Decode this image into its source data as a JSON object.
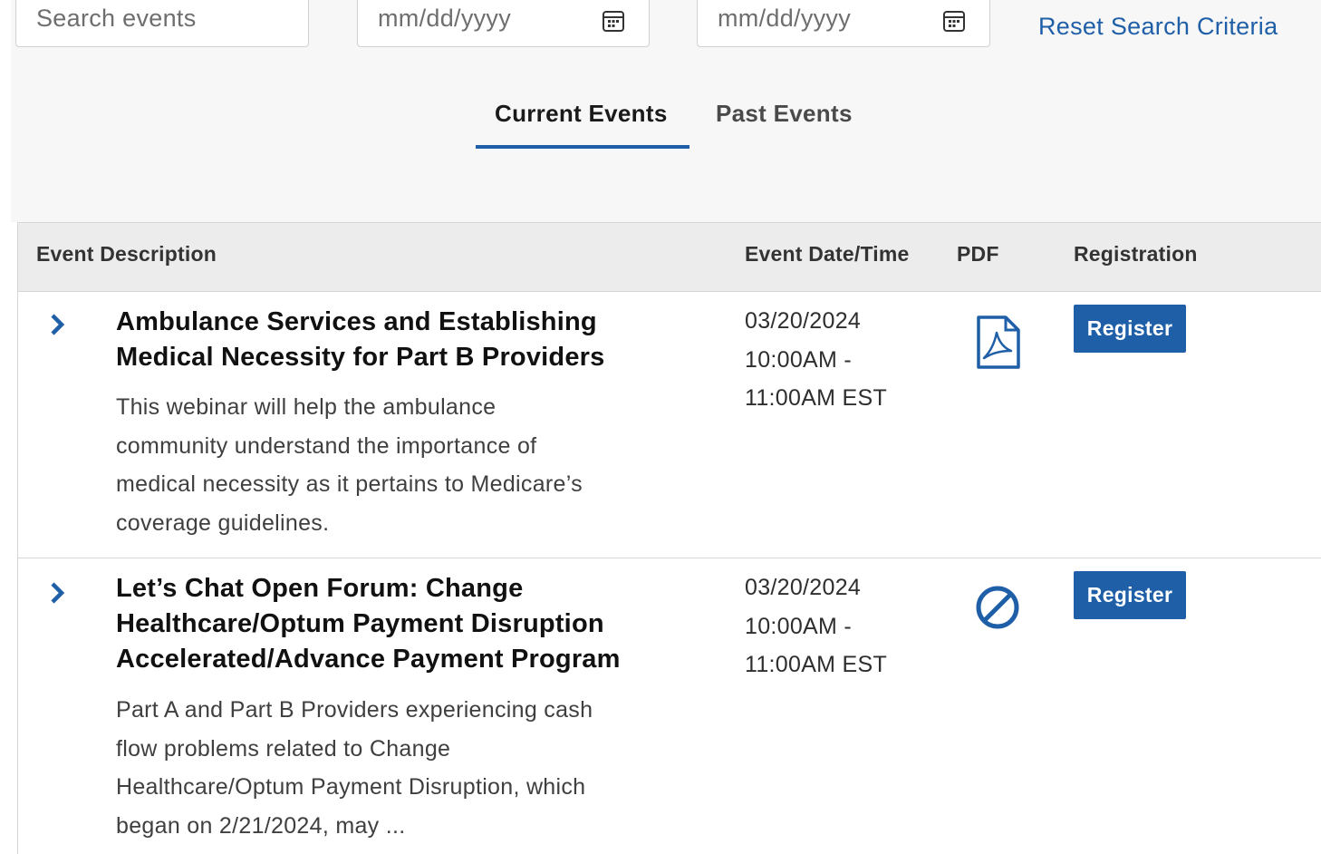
{
  "filters": {
    "search": {
      "placeholder": "Search events",
      "value": ""
    },
    "start_date": {
      "placeholder": "mm/dd/yyyy",
      "value": ""
    },
    "end_date": {
      "placeholder": "mm/dd/yyyy",
      "value": ""
    },
    "reset_label": "Reset Search Criteria"
  },
  "tabs": [
    {
      "label": "Current Events",
      "active": true
    },
    {
      "label": "Past Events",
      "active": false
    }
  ],
  "table": {
    "columns": [
      "Event Description",
      "Event Date/Time",
      "PDF",
      "Registration"
    ],
    "rows": [
      {
        "title_lines": [
          "Ambulance Services and Establishing",
          "Medical Necessity for Part B Providers"
        ],
        "description_lines": [
          "This webinar will help the ambulance",
          "community understand the importance of",
          "medical necessity as it pertains to Medicare’s",
          "coverage guidelines."
        ],
        "date_lines": [
          "03/20/2024",
          "10:00AM -",
          "11:00AM EST"
        ],
        "pdf": "pdf-file-icon",
        "register_label": "Register"
      },
      {
        "title_lines": [
          "Let’s Chat Open Forum: Change",
          "Healthcare/Optum Payment Disruption",
          "Accelerated/Advance Payment Program"
        ],
        "description_lines": [
          "Part A and Part B Providers experiencing cash",
          "flow problems related to Change",
          "Healthcare/Optum Payment Disruption, which",
          "began on 2/21/2024, may ..."
        ],
        "date_lines": [
          "03/20/2024",
          "10:00AM -",
          "11:00AM EST"
        ],
        "pdf": "no-pdf-icon",
        "register_label": "Register"
      }
    ]
  },
  "colors": {
    "accent": "#1f5fa8",
    "header_bg": "#ececec",
    "panel_bg": "#f7f7f7"
  }
}
